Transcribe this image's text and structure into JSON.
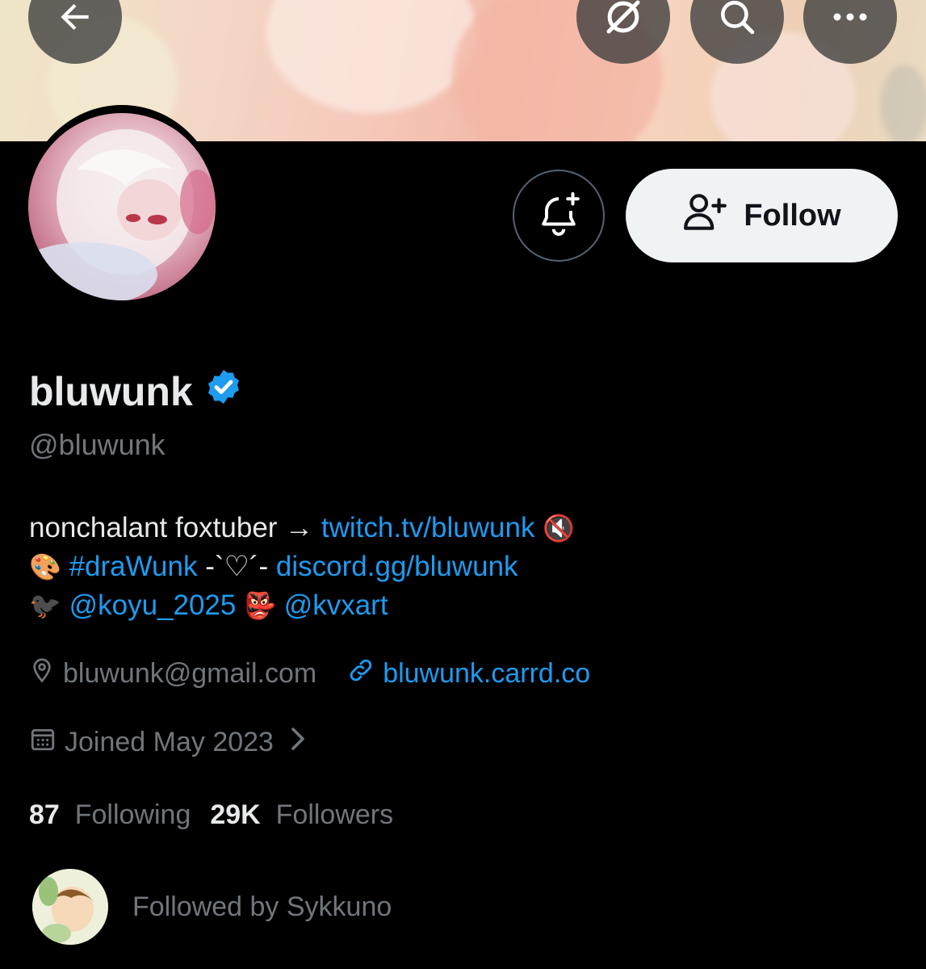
{
  "header": {
    "back_icon": "arrow-left-icon",
    "grok_icon": "grok-icon",
    "search_icon": "search-icon",
    "more_icon": "more-horizontal-icon"
  },
  "profile": {
    "display_name": "bluwunk",
    "handle": "@bluwunk",
    "verified": true,
    "bio": {
      "line1_text": "nonchalant foxtuber → ",
      "line1_link": "twitch.tv/bluwunk",
      "line1_emoji": "🔇",
      "line2_emoji": "🎨",
      "line2_hashtag": "#draWunk",
      "line2_text": " -`♡´- ",
      "line2_link": "discord.gg/bluwunk",
      "line3_emoji1": "🐦‍⬛",
      "line3_mention1": "@koyu_2025",
      "line3_emoji2": "👺",
      "line3_mention2": "@kvxart"
    },
    "location": "bluwunk@gmail.com",
    "website": "bluwunk.carrd.co",
    "joined": "Joined May 2023",
    "following_count": "87",
    "following_label": "Following",
    "followers_count": "29K",
    "followers_label": "Followers",
    "followed_by": "Followed by Sykkuno"
  },
  "actions": {
    "follow_label": "Follow"
  },
  "colors": {
    "accent": "#1d9bf0",
    "muted": "#71767b",
    "text": "#e7e9ea",
    "background": "#000000"
  }
}
